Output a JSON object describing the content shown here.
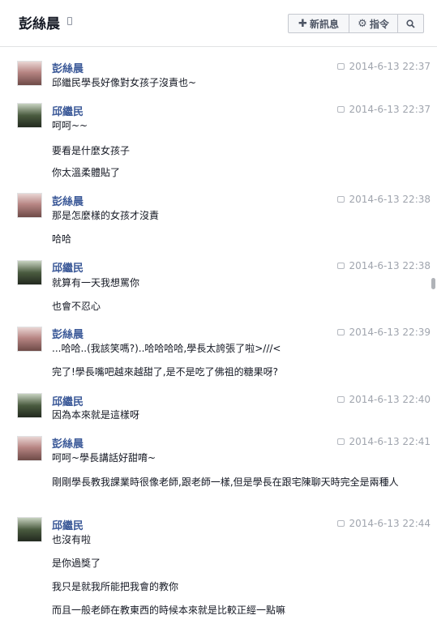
{
  "header": {
    "title": "彭絲晨",
    "new_message_label": "新訊息",
    "actions_label": "指令"
  },
  "messages": [
    {
      "sender": "彭絲晨",
      "time": "2014-6-13 22:37",
      "lines": [
        "邱繼民學長好像對女孩子沒責也~"
      ]
    },
    {
      "sender": "邱繼民",
      "time": "2014-6-13 22:37",
      "lines": [
        "呵呵~~",
        "要看是什麼女孩子",
        "你太溫柔體貼了"
      ]
    },
    {
      "sender": "彭絲晨",
      "time": "2014-6-13 22:38",
      "lines": [
        "那是怎麼樣的女孩才沒責",
        "哈哈"
      ]
    },
    {
      "sender": "邱繼民",
      "time": "2014-6-13 22:38",
      "lines": [
        "就算有一天我想罵你",
        "也會不忍心"
      ]
    },
    {
      "sender": "彭絲晨",
      "time": "2014-6-13 22:39",
      "lines": [
        "...哈哈..(我該笑嗎?)..哈哈哈哈,學長太誇張了啦>///<",
        "完了!學長嘴吧越來越甜了,是不是吃了佛祖的糖果呀?"
      ]
    },
    {
      "sender": "邱繼民",
      "time": "2014-6-13 22:40",
      "lines": [
        "因為本來就是這樣呀"
      ]
    },
    {
      "sender": "彭絲晨",
      "time": "2014-6-13 22:41",
      "lines": [
        "呵呵~學長講話好甜唷~",
        "剛剛學長教我課業時很像老師,跟老師一樣,但是學長在跟宅陳聊天時完全是兩種人"
      ]
    },
    {
      "sender": "邱繼民",
      "time": "2014-6-13 22:44",
      "lines": [
        "也沒有啦",
        "是你過獎了",
        "我只是就我所能把我會的教你",
        "而且一般老師在教東西的時候本來就是比較正經一點嘛"
      ]
    }
  ]
}
